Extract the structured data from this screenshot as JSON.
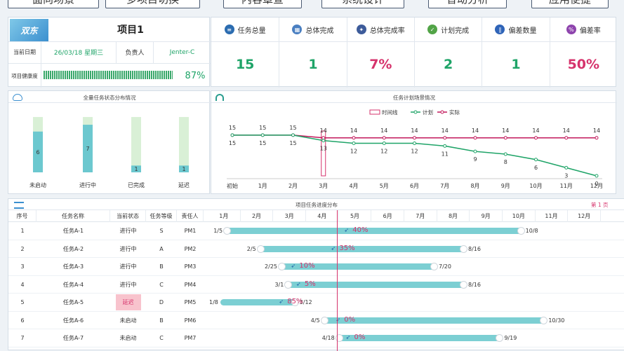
{
  "top_buttons": [
    "面向场景",
    "多项目切换",
    "内容章查",
    "系统设计",
    "智动分析",
    "应用便捷"
  ],
  "project": {
    "logo_text": "双东 ",
    "title": "项目1",
    "date_label": "当前日期",
    "date_value": "26/03/18 星期三",
    "owner_label": "负责人",
    "owner_value": "Jenter-C",
    "health_label": "项目健康度",
    "health_value": "87%",
    "health_pct": 87
  },
  "stats": [
    {
      "icon": "layers-icon",
      "label": "任务总量",
      "value": "15",
      "color": "#1fa468",
      "icon_color": "#2b6cb0"
    },
    {
      "icon": "grid-icon",
      "label": "总体完成",
      "value": "1",
      "color": "#1fa468",
      "icon_color": "#4a7fc1"
    },
    {
      "icon": "compass-icon",
      "label": "总体完成率",
      "value": "7%",
      "color": "#d6336c",
      "icon_color": "#3d5b9a"
    },
    {
      "icon": "check-icon",
      "label": "计划完成",
      "value": "2",
      "color": "#1fa468",
      "icon_color": "#52a447"
    },
    {
      "icon": "bars-icon",
      "label": "偏差数量",
      "value": "1",
      "color": "#1fa468",
      "icon_color": "#2f64b8"
    },
    {
      "icon": "percent-icon",
      "label": "偏差率",
      "value": "50%",
      "color": "#d6336c",
      "icon_color": "#8e44ad"
    }
  ],
  "status_chart": {
    "title": "全量任务状态分布情况",
    "type": "bar",
    "categories": [
      "未启动",
      "进行中",
      "已完成",
      "延迟"
    ],
    "values": [
      6,
      7,
      1,
      1
    ],
    "total": 7
  },
  "line_chart": {
    "title": "任务计划场景情况",
    "type": "line",
    "legend": [
      "时间线",
      "计划",
      "实际"
    ],
    "categories": [
      "初始",
      "1月",
      "2月",
      "3月",
      "4月",
      "5月",
      "6月",
      "7月",
      "8月",
      "9月",
      "10月",
      "11月",
      "12月"
    ],
    "series": [
      {
        "name": "实际",
        "color": "#c2185b",
        "values": [
          15,
          15,
          15,
          14,
          14,
          14,
          14,
          14,
          14,
          14,
          14,
          14,
          14
        ]
      },
      {
        "name": "计划",
        "color": "#1fa468",
        "values": [
          15,
          15,
          15,
          13,
          12,
          12,
          12,
          11,
          9,
          8,
          6,
          3,
          0
        ]
      }
    ],
    "ylim": [
      0,
      16
    ],
    "timeline_index": 3
  },
  "gantt": {
    "title": "项目任务进度分布",
    "page_label": "第 1 页",
    "columns": [
      "序号",
      "任务名称",
      "当前状态",
      "任务等级",
      "责任人"
    ],
    "months": [
      "1月",
      "2月",
      "3月",
      "4月",
      "5月",
      "6月",
      "7月",
      "8月",
      "9月",
      "10月",
      "11月",
      "12月"
    ],
    "today": 3.55,
    "rows": [
      {
        "no": "1",
        "name": "任务A-1",
        "status": "进行中",
        "level": "S",
        "owner": "PM1",
        "start_label": "1/5",
        "end_label": "10/8",
        "start": 0.13,
        "end": 9.25,
        "pct": "40%",
        "progress": 0.4,
        "late": false
      },
      {
        "no": "2",
        "name": "任务A-2",
        "status": "进行中",
        "level": "A",
        "owner": "PM2",
        "start_label": "2/5",
        "end_label": "8/16",
        "start": 1.15,
        "end": 7.5,
        "pct": "35%",
        "progress": 0.35,
        "late": false
      },
      {
        "no": "3",
        "name": "任务A-3",
        "status": "进行中",
        "level": "B",
        "owner": "PM3",
        "start_label": "2/25",
        "end_label": "7/20",
        "start": 1.8,
        "end": 6.6,
        "pct": "10%",
        "progress": 0.1,
        "late": false
      },
      {
        "no": "4",
        "name": "任务A-4",
        "status": "进行中",
        "level": "C",
        "owner": "PM4",
        "start_label": "3/1",
        "end_label": "8/16",
        "start": 2.0,
        "end": 7.5,
        "pct": "5%",
        "progress": 0.05,
        "late": false
      },
      {
        "no": "5",
        "name": "任务A-5",
        "status": "延迟",
        "level": "D",
        "owner": "PM5",
        "start_label": "1/8",
        "end_label": "3/12",
        "start": 0.0,
        "end": 2.35,
        "pct": "85%",
        "progress": 0.85,
        "late": true
      },
      {
        "no": "6",
        "name": "任务A-6",
        "status": "未启动",
        "level": "B",
        "owner": "PM6",
        "start_label": "4/5",
        "end_label": "10/30",
        "start": 3.1,
        "end": 9.95,
        "pct": "0%",
        "progress": 0.0,
        "late": false
      },
      {
        "no": "7",
        "name": "任务A-7",
        "status": "未启动",
        "level": "C",
        "owner": "PM7",
        "start_label": "4/18",
        "end_label": "9/19",
        "start": 3.55,
        "end": 8.6,
        "pct": "0%",
        "progress": 0.0,
        "late": false
      }
    ]
  }
}
